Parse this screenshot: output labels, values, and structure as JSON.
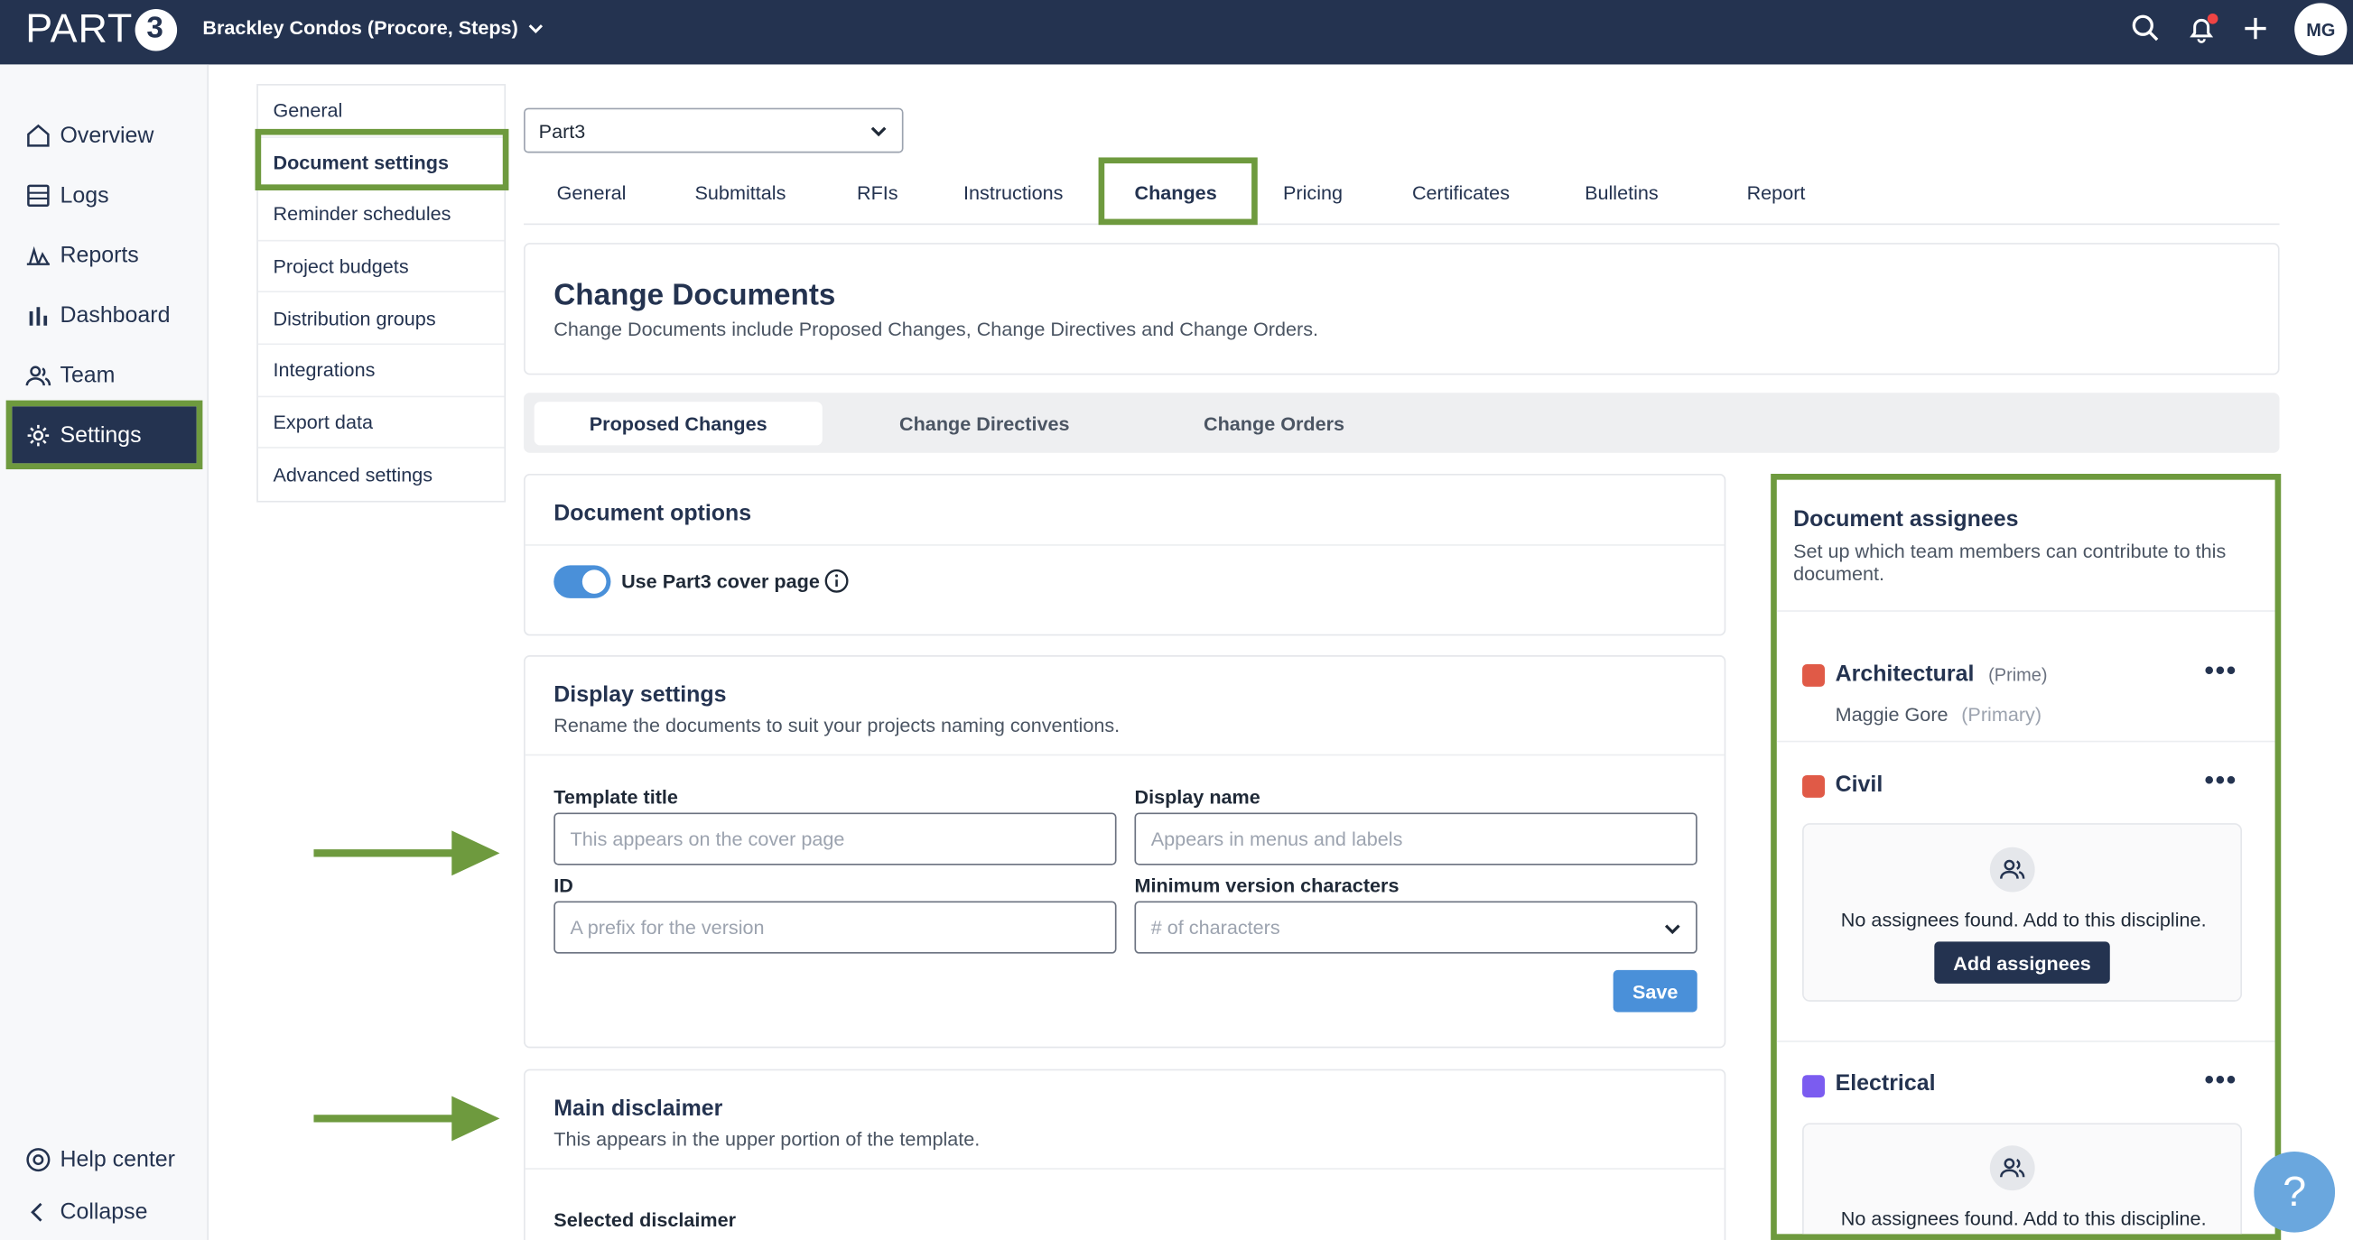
{
  "topbar": {
    "logo_text": "PART",
    "logo_badge": "3",
    "project_name": "Brackley Condos (Procore, Steps)",
    "avatar_initials": "MG"
  },
  "leftnav": {
    "items": [
      {
        "label": "Overview",
        "icon": "home-icon"
      },
      {
        "label": "Logs",
        "icon": "logs-icon"
      },
      {
        "label": "Reports",
        "icon": "reports-icon"
      },
      {
        "label": "Dashboard",
        "icon": "bar-chart-icon"
      },
      {
        "label": "Team",
        "icon": "team-icon"
      },
      {
        "label": "Settings",
        "icon": "gear-icon"
      }
    ],
    "help_center": "Help center",
    "collapse": "Collapse"
  },
  "subnav": {
    "items": [
      "General",
      "Document settings",
      "Reminder schedules",
      "Project budgets",
      "Distribution groups",
      "Integrations",
      "Export data",
      "Advanced settings"
    ]
  },
  "org_select": {
    "value": "Part3"
  },
  "tabs": [
    "General",
    "Submittals",
    "RFIs",
    "Instructions",
    "Changes",
    "Pricing",
    "Certificates",
    "Bulletins",
    "Report"
  ],
  "header": {
    "title": "Change Documents",
    "subtitle": "Change Documents include Proposed Changes, Change Directives and Change Orders."
  },
  "segments": [
    "Proposed Changes",
    "Change Directives",
    "Change Orders"
  ],
  "document_options": {
    "title": "Document options",
    "toggle_label": "Use Part3 cover page"
  },
  "display_settings": {
    "title": "Display settings",
    "subtitle": "Rename the documents to suit your projects naming conventions.",
    "template_title_label": "Template title",
    "template_title_placeholder": "This appears on the cover page",
    "display_name_label": "Display name",
    "display_name_placeholder": "Appears in menus and labels",
    "id_label": "ID",
    "id_placeholder": "A prefix for the version",
    "min_version_label": "Minimum version characters",
    "min_version_placeholder": "# of characters",
    "save_label": "Save"
  },
  "main_disclaimer": {
    "title": "Main disclaimer",
    "subtitle": "This appears in the upper portion of the template.",
    "selected_label": "Selected disclaimer"
  },
  "assignees": {
    "title": "Document assignees",
    "subtitle": "Set up which team members can contribute to this document.",
    "disciplines": [
      {
        "name": "Architectural",
        "tag": "(Prime)",
        "color": "#e05a47",
        "member": "Maggie Gore",
        "member_tag": "(Primary)"
      },
      {
        "name": "Civil",
        "color": "#e05a47",
        "empty_text": "No assignees found. Add to this discipline.",
        "add_label": "Add assignees"
      },
      {
        "name": "Electrical",
        "color": "#7b5cf0",
        "empty_text": "No assignees found. Add to this discipline."
      }
    ]
  },
  "colors": {
    "navy": "#243350",
    "highlight": "#6e9a3e",
    "accent": "#4a90d9"
  }
}
